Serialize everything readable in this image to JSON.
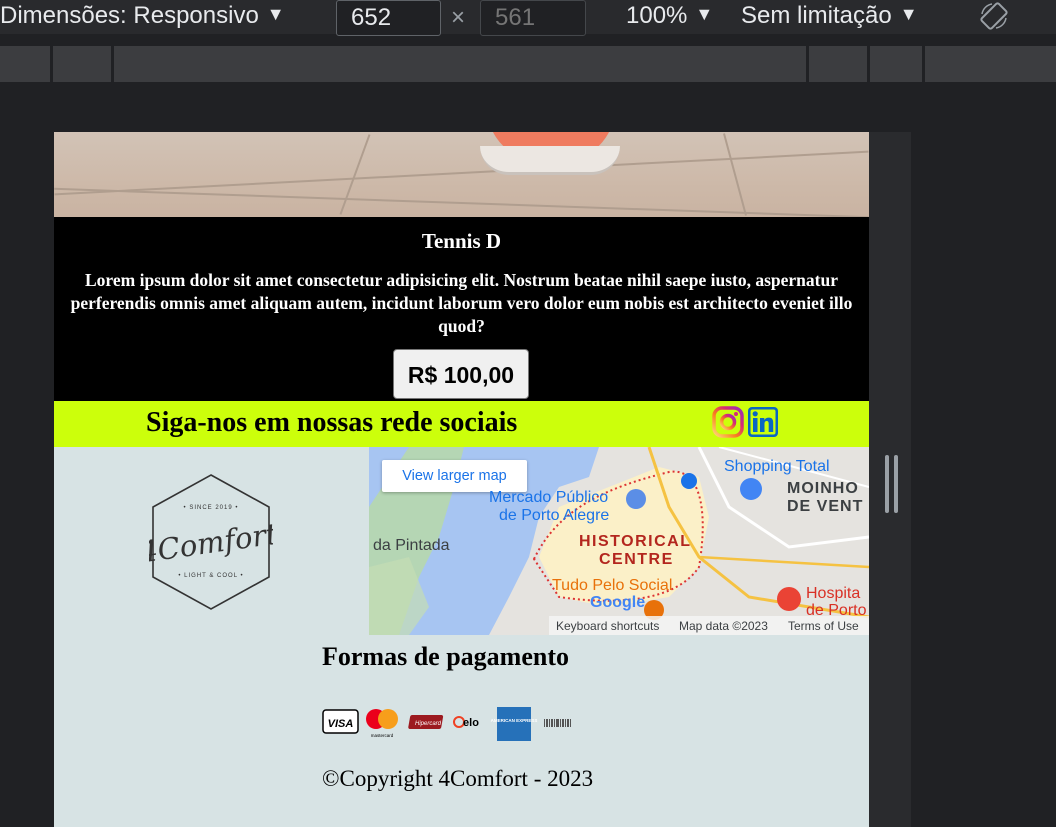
{
  "devtools": {
    "dimensions_label": "Dimensões: Responsivo",
    "width_value": "652",
    "height_placeholder": "561",
    "times": "×",
    "zoom": "100%",
    "throttle": "Sem limitação",
    "caret": "▼"
  },
  "product": {
    "title": "Tennis D",
    "description": "Lorem ipsum dolor sit amet consectetur adipisicing elit. Nostrum beatae nihil saepe iusto, aspernatur perferendis omnis amet aliquam autem, incidunt laborum vero dolor eum nobis est architecto eveniet illo quod?",
    "price": "R$ 100,00"
  },
  "social": {
    "text": "Siga-nos em nossas rede sociais",
    "icons": [
      "instagram-icon",
      "linkedin-icon"
    ]
  },
  "logo": {
    "name": "4Comfort",
    "since": "• SINCE 2019 •",
    "tagline": "• LIGHT & COOL •"
  },
  "map": {
    "link": "View larger map",
    "labels": {
      "mercado": "Mercado Público",
      "mercado2": "de Porto Alegre",
      "shopping": "Shopping Total",
      "moinho": "MOINHO",
      "vent": "DE VENT",
      "pintada": "da Pintada",
      "historical": "HISTORICAL",
      "centre": "CENTRE",
      "tudo": "Tudo Pelo Social",
      "hospital": "Hospita",
      "porto": "de Porto",
      "google": "Google"
    },
    "footer": {
      "shortcuts": "Keyboard shortcuts",
      "mapdata": "Map data ©2023",
      "terms": "Terms of Use"
    }
  },
  "payment": {
    "title": "Formas de pagamento",
    "cards": [
      "VISA",
      "mastercard",
      "Hipercard",
      "elo",
      "AMERICAN EXPRESS",
      "boleto"
    ]
  },
  "footer": {
    "copyright": "©Copyright 4Comfort - 2023"
  },
  "colors": {
    "social_bg": "#ccff0b",
    "footer_bg": "#d7e3e4",
    "product_bg": "#000000"
  }
}
